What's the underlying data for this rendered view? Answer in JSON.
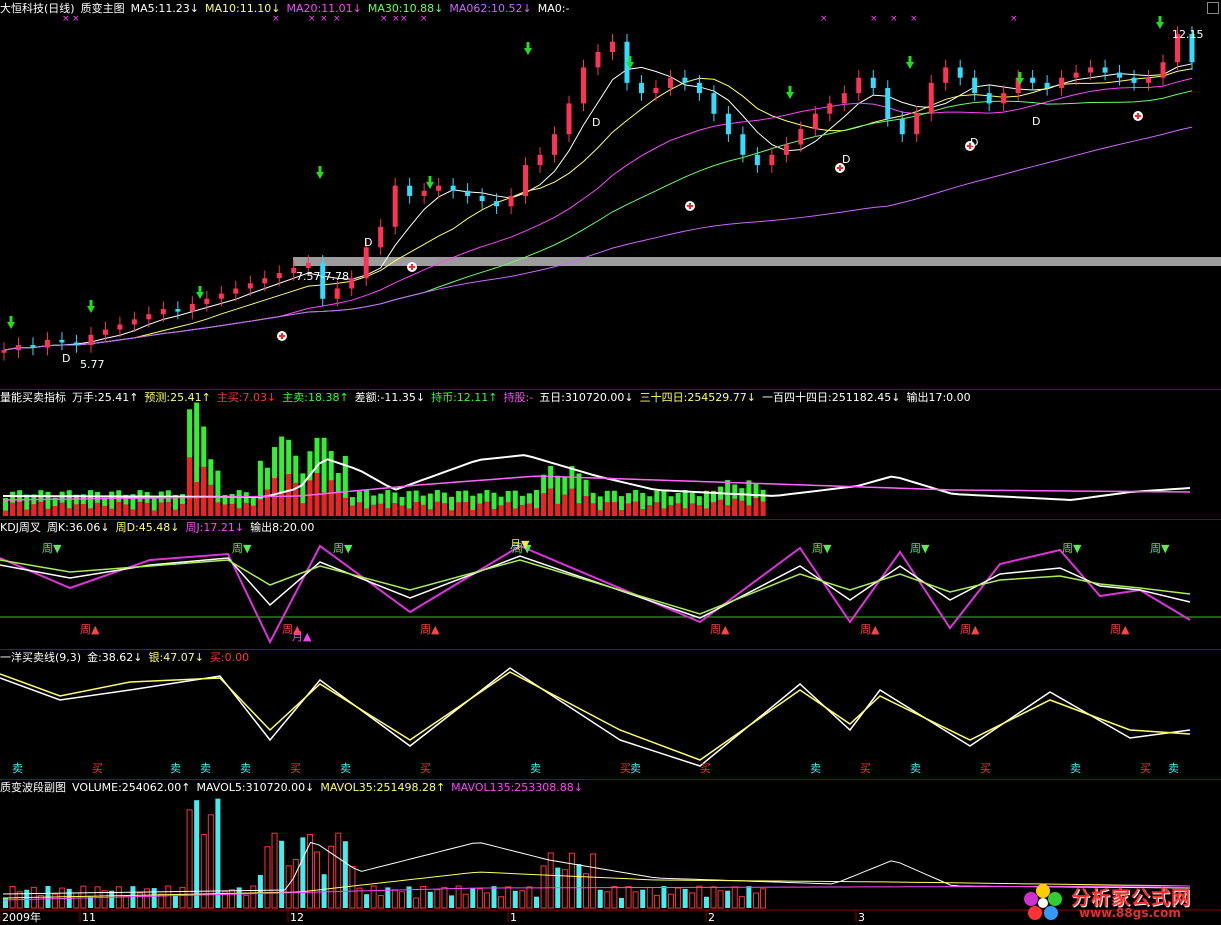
{
  "main_header": [
    {
      "text": "大恒科技(日线)",
      "color": "#ffffff"
    },
    {
      "text": "质变主图",
      "color": "#ffffff"
    },
    {
      "text": "MA5:11.23↓",
      "color": "#ffffff"
    },
    {
      "text": "MA10:11.10↓",
      "color": "#ffff66"
    },
    {
      "text": "MA20:11.01↓",
      "color": "#ff44ff"
    },
    {
      "text": "MA30:10.88↓",
      "color": "#66ff66"
    },
    {
      "text": "MA062:10.52↓",
      "color": "#cc66ff"
    },
    {
      "text": "MA0:-",
      "color": "#ffffff"
    }
  ],
  "energy_header": [
    {
      "text": "量能买卖指标",
      "color": "#ffffff"
    },
    {
      "text": "万手:25.41↑",
      "color": "#ffffff"
    },
    {
      "text": "预测:25.41↑",
      "color": "#ffff66"
    },
    {
      "text": "主买:7.03↓",
      "color": "#ff3333"
    },
    {
      "text": "主卖:18.38↑",
      "color": "#33ff33"
    },
    {
      "text": "差额:-11.35↓",
      "color": "#ffffff"
    },
    {
      "text": "持币:12.11↑",
      "color": "#33ff33"
    },
    {
      "text": "持股:-",
      "color": "#ff44ff"
    },
    {
      "text": "五日:310720.00↓",
      "color": "#ffffff"
    },
    {
      "text": "三十四日:254529.77↓",
      "color": "#ffff66"
    },
    {
      "text": "一百四十四日:251182.45↓",
      "color": "#ffffff"
    },
    {
      "text": "输出17:0.00",
      "color": "#ffffff"
    }
  ],
  "kdj_header": [
    {
      "text": "KDJ周叉",
      "color": "#ffffff"
    },
    {
      "text": "周K:36.06↓",
      "color": "#ffffff"
    },
    {
      "text": "周D:45.48↓",
      "color": "#ffff66"
    },
    {
      "text": "周J:17.21↓",
      "color": "#ff44ff"
    },
    {
      "text": "输出8:20.00",
      "color": "#ffffff"
    }
  ],
  "gold_header": [
    {
      "text": "一洋买卖线(9,3)",
      "color": "#ffffff"
    },
    {
      "text": "金:38.62↓",
      "color": "#ffffff"
    },
    {
      "text": "银:47.07↓",
      "color": "#ffff66"
    },
    {
      "text": "买:0.00",
      "color": "#ff3333"
    }
  ],
  "vol_header": [
    {
      "text": "质变波段副图",
      "color": "#ffffff"
    },
    {
      "text": "VOLUME:254062.00↑",
      "color": "#ffffff"
    },
    {
      "text": "MAVOL5:310720.00↓",
      "color": "#ffffff"
    },
    {
      "text": "MAVOL35:251498.28↑",
      "color": "#ffff66"
    },
    {
      "text": "MAVOL135:253308.88↓",
      "color": "#ff44ff"
    }
  ],
  "price_labels": {
    "high": "12.15",
    "low": "5.77",
    "gap": "7.57-7.78"
  },
  "marker_d": "D",
  "kdj_marks": {
    "week": "周",
    "up": "▲",
    "down": "▼",
    "month": "月"
  },
  "signals": {
    "buy": "买",
    "sell": "卖"
  },
  "dates": [
    {
      "text": "2009年",
      "color": "#ffffff"
    },
    {
      "text": "11",
      "color": "#ffffff"
    },
    {
      "text": "12",
      "color": "#ffffff"
    },
    {
      "text": "1",
      "color": "#ffffff"
    },
    {
      "text": "2",
      "color": "#ffffff"
    },
    {
      "text": "3",
      "color": "#ffffff"
    }
  ],
  "logo": {
    "main": "分析家公式网",
    "url": "www.88gs.com"
  },
  "chart_data": {
    "type": "line",
    "stock": "大恒科技",
    "period": "日线",
    "price_range": [
      5.77,
      12.15
    ],
    "close_approx": [
      6.0,
      6.1,
      6.05,
      6.2,
      6.15,
      6.1,
      6.3,
      6.4,
      6.5,
      6.6,
      6.7,
      6.8,
      6.75,
      6.9,
      7.0,
      7.1,
      7.2,
      7.3,
      7.4,
      7.5,
      7.6,
      7.7,
      7.0,
      7.2,
      7.4,
      8.0,
      8.4,
      9.2,
      9.0,
      9.1,
      9.2,
      9.1,
      9.0,
      8.9,
      8.8,
      9.0,
      9.6,
      9.8,
      10.2,
      10.8,
      11.5,
      11.8,
      12.0,
      11.2,
      11.0,
      11.1,
      11.3,
      11.2,
      11.0,
      10.6,
      10.2,
      9.8,
      9.6,
      9.8,
      10.0,
      10.3,
      10.6,
      10.8,
      11.0,
      11.3,
      11.1,
      10.5,
      10.2,
      10.6,
      11.2,
      11.5,
      11.3,
      11.0,
      10.8,
      11.0,
      11.3,
      11.2,
      11.1,
      11.3,
      11.4,
      11.5,
      11.4,
      11.3,
      11.2,
      11.3,
      11.6,
      12.15,
      11.6
    ]
  }
}
